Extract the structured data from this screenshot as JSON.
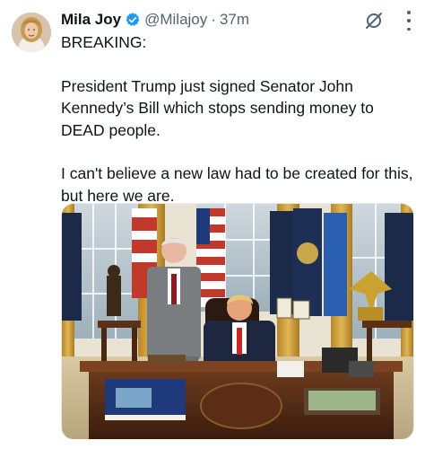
{
  "tweet": {
    "author_name": "Mila Joy",
    "handle": "@Milajoy",
    "separator": "·",
    "time": "37m",
    "paragraphs": [
      "BREAKING:",
      "President Trump just signed Senator John Kennedy’s Bill which stops sending money to DEAD people.",
      "I can't believe a new law had to be created for this, but here we are."
    ]
  },
  "icons": {
    "verified": "verified-badge-icon",
    "grok": "grok-icon",
    "more": "more-options-icon"
  },
  "colors": {
    "text": "#0f1419",
    "secondary": "#536471",
    "verified_blue": "#1d9bf0"
  }
}
